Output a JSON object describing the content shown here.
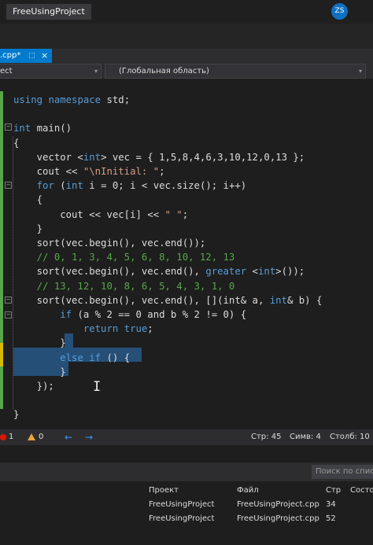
{
  "titlebar": {
    "project_badge": "FreeUsingProject",
    "user_initials": "ZS"
  },
  "tab": {
    "name": ".cpp*",
    "pin_glyph": "⬚",
    "close_glyph": "×"
  },
  "navbar": {
    "project_combo": "ect",
    "scope_combo": "(Глобальная область)",
    "arrow_glyph": "▾"
  },
  "code": {
    "lines": [
      {
        "parts": [
          {
            "c": "kw",
            "t": "using"
          },
          {
            "t": " "
          },
          {
            "c": "kw",
            "t": "namespace"
          },
          {
            "t": " std;"
          }
        ]
      },
      {
        "parts": [
          {
            "t": ""
          }
        ]
      },
      {
        "parts": [
          {
            "c": "kw",
            "t": "int"
          },
          {
            "t": " main()"
          }
        ]
      },
      {
        "parts": [
          {
            "t": "{"
          }
        ]
      },
      {
        "parts": [
          {
            "t": "    vector <"
          },
          {
            "c": "kw",
            "t": "int"
          },
          {
            "t": "> vec = { 1,5,8,4,6,3,10,12,0,13 };"
          }
        ]
      },
      {
        "parts": [
          {
            "t": "    cout << "
          },
          {
            "c": "str",
            "t": "\"\\nInitial: \""
          },
          {
            "t": ";"
          }
        ]
      },
      {
        "parts": [
          {
            "t": "    "
          },
          {
            "c": "kw",
            "t": "for"
          },
          {
            "t": " ("
          },
          {
            "c": "kw",
            "t": "int"
          },
          {
            "t": " i = 0; i < vec.size(); i++)"
          }
        ]
      },
      {
        "parts": [
          {
            "t": "    {"
          }
        ]
      },
      {
        "parts": [
          {
            "t": "        cout << vec[i] << "
          },
          {
            "c": "str",
            "t": "\" \""
          },
          {
            "t": ";"
          }
        ]
      },
      {
        "parts": [
          {
            "t": "    }"
          }
        ]
      },
      {
        "parts": [
          {
            "t": "    sort(vec.begin(), vec.end());"
          }
        ]
      },
      {
        "parts": [
          {
            "c": "cm",
            "t": "    // 0, 1, 3, 4, 5, 6, 8, 10, 12, 13"
          }
        ]
      },
      {
        "parts": [
          {
            "t": "    sort(vec.begin(), vec.end(), "
          },
          {
            "c": "kw",
            "t": "greater"
          },
          {
            "t": " <"
          },
          {
            "c": "kw",
            "t": "int"
          },
          {
            "t": ">());"
          }
        ]
      },
      {
        "parts": [
          {
            "c": "cm",
            "t": "    // 13, 12, 10, 8, 6, 5, 4, 3, 1, 0"
          }
        ]
      },
      {
        "parts": [
          {
            "t": "    sort(vec.begin(), vec.end(), [](int& a, "
          },
          {
            "c": "kw",
            "t": "int"
          },
          {
            "t": "& b) {"
          }
        ]
      },
      {
        "parts": [
          {
            "t": "        "
          },
          {
            "c": "kw",
            "t": "if"
          },
          {
            "t": " (a % 2 == 0 and b % 2 != 0) {"
          }
        ]
      },
      {
        "parts": [
          {
            "t": "            "
          },
          {
            "c": "kw",
            "t": "return"
          },
          {
            "t": " "
          },
          {
            "c": "kw",
            "t": "true"
          },
          {
            "t": ";"
          }
        ]
      },
      {
        "parts": [
          {
            "t": "        }"
          }
        ]
      },
      {
        "parts": [
          {
            "t": "        "
          },
          {
            "c": "kw",
            "t": "else"
          },
          {
            "t": " "
          },
          {
            "c": "kw",
            "t": "if"
          },
          {
            "t": " () {"
          }
        ]
      },
      {
        "parts": [
          {
            "t": "        }"
          }
        ]
      },
      {
        "parts": [
          {
            "t": "    });"
          }
        ]
      },
      {
        "parts": [
          {
            "t": ""
          }
        ]
      },
      {
        "parts": [
          {
            "t": "}"
          }
        ]
      }
    ]
  },
  "statusbar": {
    "errors": "1",
    "warnings": "0",
    "back_arrow": "←",
    "forward_arrow": "→",
    "line": "Стр: 45",
    "char": "Симв: 4",
    "column": "Столб: 10"
  },
  "panel": {
    "search_placeholder": "Поиск по спис",
    "headers": [
      "Проект",
      "Файл",
      "Стр",
      "Состо"
    ],
    "rows": [
      [
        "FreeUsingProject",
        "FreeUsingProject.cpp",
        "34"
      ],
      [
        "FreeUsingProject",
        "FreeUsingProject.cpp",
        "52"
      ]
    ]
  }
}
